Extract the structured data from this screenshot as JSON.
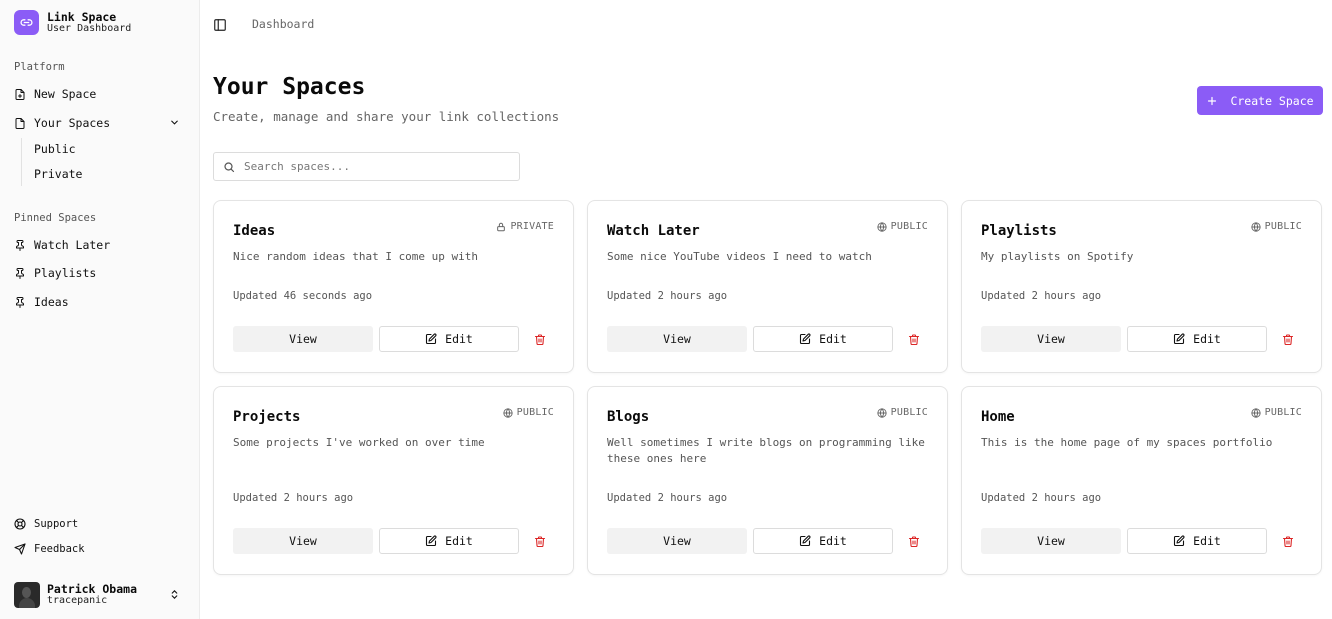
{
  "brand": {
    "title": "Link Space",
    "subtitle": "User Dashboard",
    "accent": "#8b5cf6"
  },
  "sidebar": {
    "platform_label": "Platform",
    "new_space": "New Space",
    "your_spaces": "Your Spaces",
    "sub_items": [
      "Public",
      "Private"
    ],
    "pinned_label": "Pinned Spaces",
    "pinned": [
      "Watch Later",
      "Playlists",
      "Ideas"
    ],
    "support": "Support",
    "feedback": "Feedback"
  },
  "user": {
    "name": "Patrick Obama",
    "handle": "tracepanic"
  },
  "breadcrumb": "Dashboard",
  "header": {
    "title": "Your Spaces",
    "subtitle": "Create, manage and share your link collections",
    "create_label": "Create Space"
  },
  "search": {
    "placeholder": "Search spaces..."
  },
  "buttons": {
    "view": "View",
    "edit": "Edit"
  },
  "cards": [
    {
      "title": "Ideas",
      "visibility": "PRIVATE",
      "description": "Nice random ideas that I come up with",
      "updated": "Updated 46 seconds ago"
    },
    {
      "title": "Watch Later",
      "visibility": "PUBLIC",
      "description": "Some nice YouTube videos I need to watch",
      "updated": "Updated 2 hours ago"
    },
    {
      "title": "Playlists",
      "visibility": "PUBLIC",
      "description": "My playlists on Spotify",
      "updated": "Updated 2 hours ago"
    },
    {
      "title": "Projects",
      "visibility": "PUBLIC",
      "description": "Some projects I've worked on over time",
      "updated": "Updated 2 hours ago"
    },
    {
      "title": "Blogs",
      "visibility": "PUBLIC",
      "description": "Well sometimes I write blogs on programming like these ones here",
      "updated": "Updated 2 hours ago"
    },
    {
      "title": "Home",
      "visibility": "PUBLIC",
      "description": "This is the home page of my spaces portfolio",
      "updated": "Updated 2 hours ago"
    }
  ],
  "colors": {
    "delete": "#dc2626",
    "muted": "#666666"
  }
}
